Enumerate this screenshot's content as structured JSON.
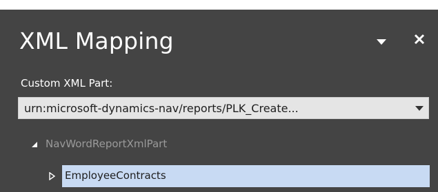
{
  "pane": {
    "title": "XML Mapping",
    "menu_icon": "chevron-down-icon",
    "close_icon": "close-icon"
  },
  "custom_xml_part": {
    "label": "Custom XML Part:",
    "selected_value": "urn:microsoft-dynamics-nav/reports/PLK_Create...",
    "arrow_icon": "dropdown-arrow-icon"
  },
  "tree": {
    "root": {
      "label": "NavWordReportXmlPart",
      "expanded": true
    },
    "children": [
      {
        "label": "EmployeeContracts",
        "expanded": false,
        "selected": true
      }
    ]
  },
  "colors": {
    "pane_background": "#444444",
    "selection_background": "#c8daf3",
    "dropdown_background": "#e5e5e5"
  }
}
